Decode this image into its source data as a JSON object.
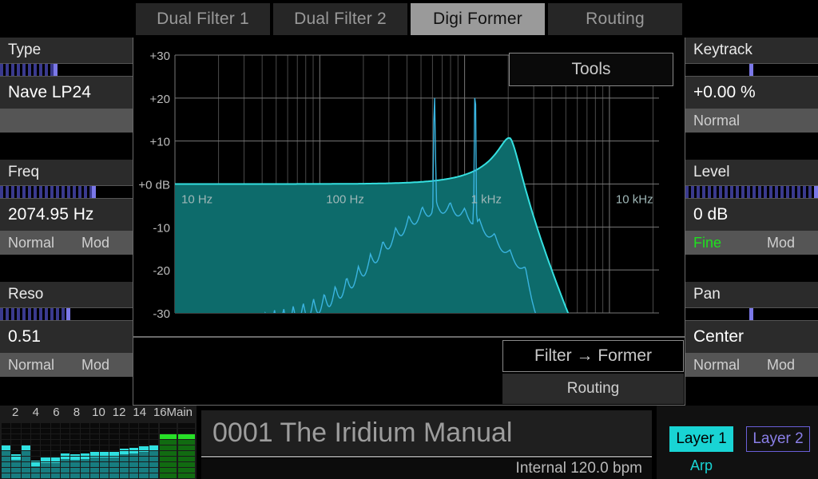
{
  "tabs": [
    {
      "label": "Dual Filter 1",
      "active": false
    },
    {
      "label": "Dual Filter 2",
      "active": false
    },
    {
      "label": "Digi Former",
      "active": true
    },
    {
      "label": "Routing",
      "active": false
    }
  ],
  "left_params": [
    {
      "title": "Type",
      "value": "Nave LP24",
      "sub1": "",
      "sub2": "",
      "bar_fill": 0.42,
      "bar_cursor": 0.42,
      "has_sub": true
    },
    {
      "title": "Freq",
      "value": "2074.95 Hz",
      "sub1": "Normal",
      "sub2": "Mod",
      "bar_fill": 0.71,
      "bar_cursor": 0.71,
      "has_sub": true
    },
    {
      "title": "Reso",
      "value": "0.51",
      "sub1": "Normal",
      "sub2": "Mod",
      "bar_fill": 0.52,
      "bar_cursor": 0.52,
      "has_sub": true
    }
  ],
  "right_params": [
    {
      "title": "Keytrack",
      "value": "+0.00 %",
      "sub1": "Normal",
      "sub2": "",
      "bar_fill": 0.0,
      "bar_cursor": 0.5,
      "has_sub": true,
      "sub2_green": false
    },
    {
      "title": "Level",
      "value": "0 dB",
      "sub1": "Fine",
      "sub2": "Mod",
      "bar_fill": 0.985,
      "bar_cursor": 0.985,
      "has_sub": true,
      "sub1_green": true
    },
    {
      "title": "Pan",
      "value": "Center",
      "sub1": "Normal",
      "sub2": "Mod",
      "bar_fill": 0.0,
      "bar_cursor": 0.5,
      "has_sub": true
    }
  ],
  "graph": {
    "tools_label": "Tools",
    "y_ticks": [
      "+30",
      "+20",
      "+10",
      "+0 dB",
      "-10",
      "-20",
      "-30"
    ],
    "x_ticks": [
      "10 Hz",
      "100 Hz",
      "1 kHz",
      "10 kHz"
    ],
    "ylim": [
      -30,
      30
    ],
    "accent_fill": "#0d6b6b",
    "accent_line": "#35e0e0",
    "analyzer_line": "#3ab4e0"
  },
  "routing": {
    "button_label": "Filter → Former",
    "panel_label": "Routing"
  },
  "meters": {
    "labels": [
      "2",
      "4",
      "6",
      "8",
      "10",
      "12",
      "14",
      "16"
    ],
    "main_label": "Main",
    "channels": [
      0.62,
      0.44,
      0.62,
      0.33,
      0.38,
      0.38,
      0.46,
      0.44,
      0.46,
      0.49,
      0.49,
      0.48,
      0.55,
      0.56,
      0.58,
      0.6
    ],
    "main": [
      0.8,
      0.8
    ]
  },
  "preset": {
    "name": "0001 The Iridium Manual",
    "clock": "Internal 120.0 bpm"
  },
  "layers": {
    "layer1": "Layer 1",
    "layer2": "Layer 2",
    "arp": "Arp"
  }
}
